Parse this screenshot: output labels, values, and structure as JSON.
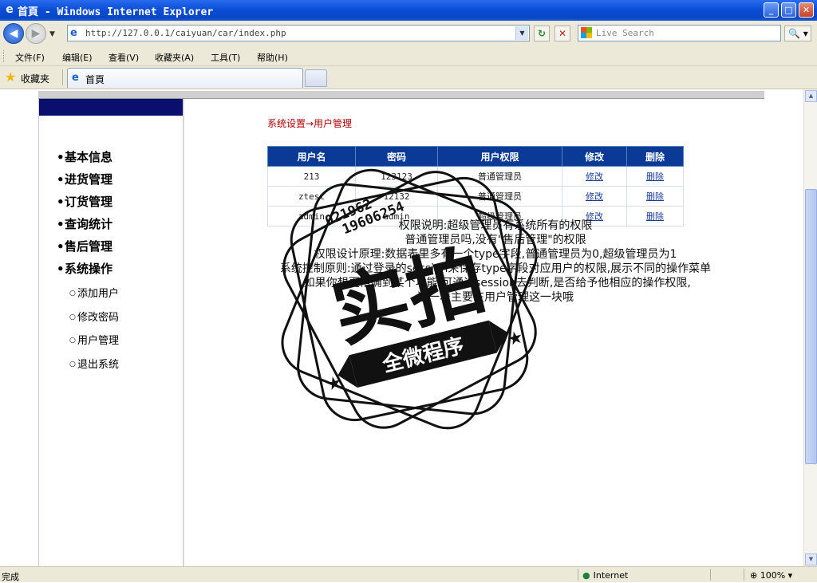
{
  "window": {
    "title": "首頁 - Windows Internet Explorer",
    "minimize": "_",
    "maximize": "□",
    "close": "✕"
  },
  "address_bar": {
    "url": "http://127.0.0.1/caiyuan/car/index.php",
    "search_placeholder": "Live Search"
  },
  "menu": [
    "文件(F)",
    "编辑(E)",
    "查看(V)",
    "收藏夹(A)",
    "工具(T)",
    "帮助(H)"
  ],
  "favorites": {
    "label": "收藏夹",
    "tab_title": "首頁"
  },
  "sidebar": {
    "items": [
      "基本信息",
      "进货管理",
      "订货管理",
      "查询统计",
      "售后管理",
      "系统操作"
    ],
    "subitems": [
      "添加用户",
      "修改密码",
      "用户管理",
      "退出系统"
    ]
  },
  "breadcrumb": "系统设置→用户管理",
  "table": {
    "headers": [
      "用户名",
      "密码",
      "用户权限",
      "修改",
      "删除"
    ],
    "rows": [
      {
        "username": "213",
        "password": "123123",
        "role": "普通管理员",
        "edit": "修改",
        "delete": "删除"
      },
      {
        "username": "ztest",
        "password": "12132",
        "role": "普通管理员",
        "edit": "修改",
        "delete": "删除"
      },
      {
        "username": "admin",
        "password": "admin",
        "role": "超级管理员",
        "edit": "修改",
        "delete": "删除"
      }
    ]
  },
  "notes": [
    "权限说明:超级管理员有系统所有的权限",
    "普通管理员吗,没有\"售后管理\"的权限",
    "权限设计原理:数据表里多有一个type字段,普通管理员为0,超级管理员为1",
    "系统控制原则:通过登录的session来保存type字段对应用户的权限,展示不同的操作菜单",
    ",如果你想更精确到某个功能,可通过session去判断,是否给予他相应的操作权限,",
    "这一块主要在用户管理这一块哦"
  ],
  "watermark": {
    "main": "实拍",
    "banner": "全微程序",
    "phone1": "021962",
    "phone2": "19606254"
  },
  "status": {
    "text": "完成",
    "zone": "Internet",
    "zoom": "100%"
  }
}
